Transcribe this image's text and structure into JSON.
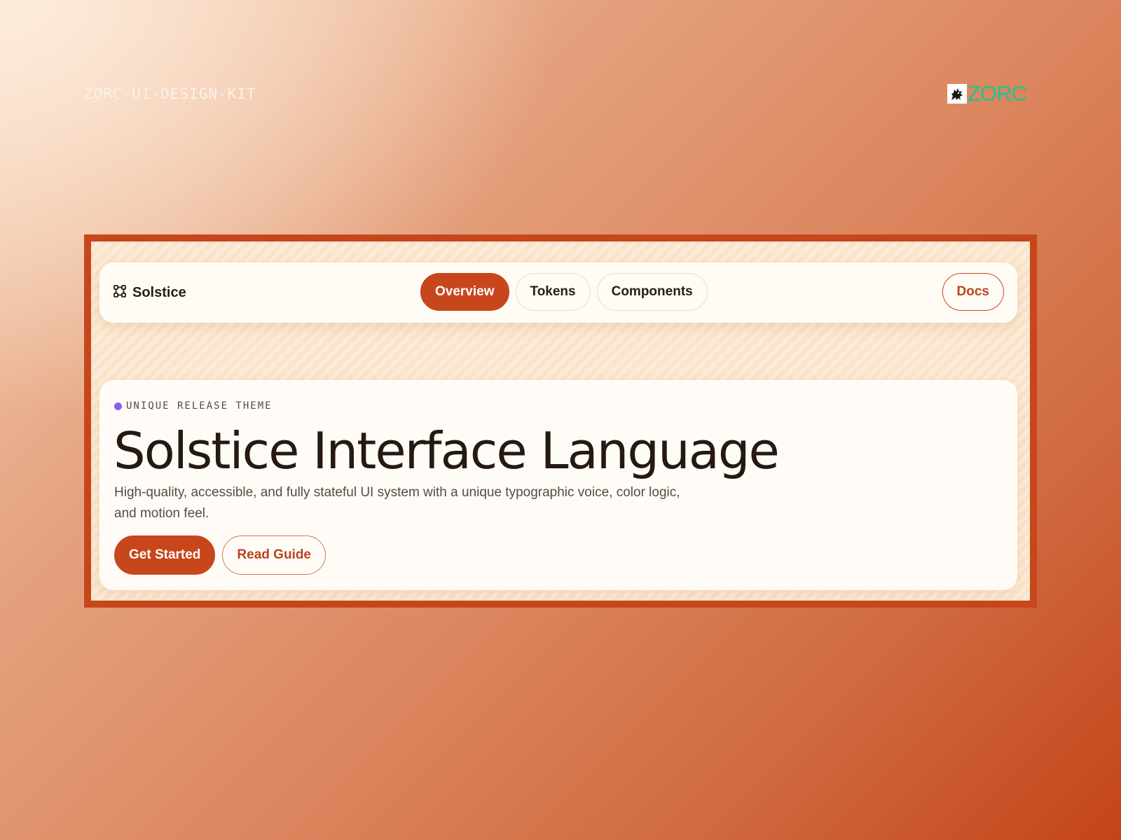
{
  "page": {
    "kit_label": "ZORC-UI-DESIGN-KIT",
    "logo_text": "ZORC",
    "logo_icon": "wolf-mascot-icon"
  },
  "nav": {
    "brand_icon": "vector-square-icon",
    "brand_label": "Solstice",
    "tabs": [
      {
        "label": "Overview",
        "active": true
      },
      {
        "label": "Tokens",
        "active": false
      },
      {
        "label": "Components",
        "active": false
      }
    ],
    "docs_label": "Docs"
  },
  "hero": {
    "eyebrow": "UNIQUE RELEASE THEME",
    "title": "Solstice Interface Language",
    "description": "High-quality, accessible, and fully stateful UI system with a unique typographic voice, color logic, and motion feel.",
    "primary_button": "Get Started",
    "secondary_button": "Read Guide"
  },
  "colors": {
    "accent": "#c8461c",
    "text_dark": "#261911",
    "text_muted": "#5a4a40",
    "eyebrow_dot": "#8a5cf0",
    "logo_green": "#3cb98a",
    "card_bg": "#fffcf8"
  }
}
